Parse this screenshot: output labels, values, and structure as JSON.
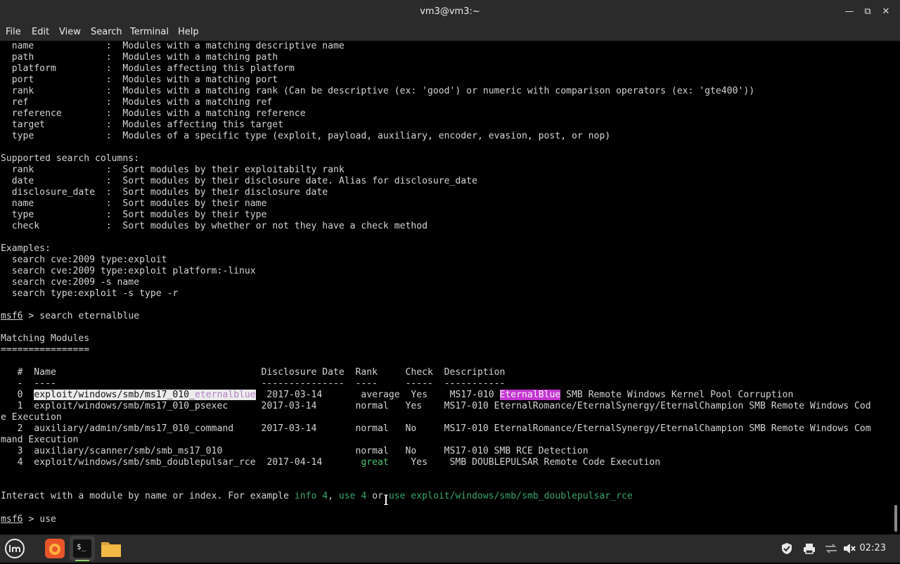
{
  "window": {
    "title": "vm3@vm3:~"
  },
  "menubar": {
    "items": [
      "File",
      "Edit",
      "View",
      "Search",
      "Terminal",
      "Help"
    ]
  },
  "terminal": {
    "lines": [
      "  name             :  Modules with a matching descriptive name",
      "  path             :  Modules with a matching path",
      "  platform         :  Modules affecting this platform",
      "  port             :  Modules with a matching port",
      "  rank             :  Modules with a matching rank (Can be descriptive (ex: 'good') or numeric with comparison operators (ex: 'gte400'))",
      "  ref              :  Modules with a matching ref",
      "  reference        :  Modules with a matching reference",
      "  target           :  Modules affecting this target",
      "  type             :  Modules of a specific type (exploit, payload, auxiliary, encoder, evasion, post, or nop)",
      "",
      "Supported search columns:",
      "  rank             :  Sort modules by their exploitabilty rank",
      "  date             :  Sort modules by their disclosure date. Alias for disclosure_date",
      "  disclosure_date  :  Sort modules by their disclosure date",
      "  name             :  Sort modules by their name",
      "  type             :  Sort modules by their type",
      "  check            :  Sort modules by whether or not they have a check method",
      "",
      "Examples:",
      "  search cve:2009 type:exploit",
      "  search cve:2009 type:exploit platform:-linux",
      "  search cve:2009 -s name",
      "  search type:exploit -s type -r",
      "",
      [
        {
          "t": "msf6",
          "c": "u"
        },
        {
          "t": " > search eternalblue"
        }
      ],
      "",
      "Matching Modules",
      "================",
      "",
      "   #  Name                                     Disclosure Date  Rank     Check  Description",
      "   -  ----                                     ---------------  ----     -----  -----------",
      [
        {
          "t": "   0  "
        },
        {
          "t": "exploit/windows/smb/ms17_010_",
          "c": "hlw"
        },
        {
          "t": "eternalblue",
          "c": "hlw pk"
        },
        {
          "t": "  2017-03-14       average  Yes    MS17-010 "
        },
        {
          "t": "EternalBlue",
          "c": "hlm"
        },
        {
          "t": " SMB Remote Windows Kernel Pool Corruption"
        }
      ],
      "   1  exploit/windows/smb/ms17_010_psexec      2017-03-14       normal   Yes    MS17-010 EternalRomance/EternalSynergy/EternalChampion SMB Remote Windows Cod",
      "e Execution",
      "   2  auxiliary/admin/smb/ms17_010_command     2017-03-14       normal   No     MS17-010 EternalRomance/EternalSynergy/EternalChampion SMB Remote Windows Com",
      "mand Execution",
      "   3  auxiliary/scanner/smb/smb_ms17_010                        normal   No     MS17-010 SMB RCE Detection",
      [
        {
          "t": "   4  exploit/windows/smb/smb_doublepulsar_rce  2017-04-14       "
        },
        {
          "t": "great",
          "c": "gr"
        },
        {
          "t": "    Yes    SMB DOUBLEPULSAR Remote Code Execution"
        }
      ],
      "",
      "",
      [
        {
          "t": "Interact with a module by name or index. For example "
        },
        {
          "t": "info 4",
          "c": "dg"
        },
        {
          "t": ", "
        },
        {
          "t": "use 4",
          "c": "dg"
        },
        {
          "t": " or "
        },
        {
          "t": "use exploit/windows/smb/smb_doublepulsar_rce",
          "c": "dg"
        }
      ],
      "",
      [
        {
          "t": "msf6",
          "c": "u"
        },
        {
          "t": " > use"
        }
      ]
    ]
  },
  "taskbar": {
    "apps": [
      {
        "name": "mint-menu",
        "icon": "mint-logo-icon"
      },
      {
        "name": "firefox",
        "icon": "firefox-icon"
      },
      {
        "name": "terminal",
        "icon": "terminal-icon",
        "label": "$_"
      },
      {
        "name": "files",
        "icon": "folder-icon"
      }
    ],
    "clock": "02:23"
  },
  "colors": {
    "panel": "#2b2b2b",
    "terminal_bg": "#000000",
    "terminal_fg": "#d3d3d3",
    "highlight_magenta": "#c436d1",
    "green": "#4ec270"
  }
}
